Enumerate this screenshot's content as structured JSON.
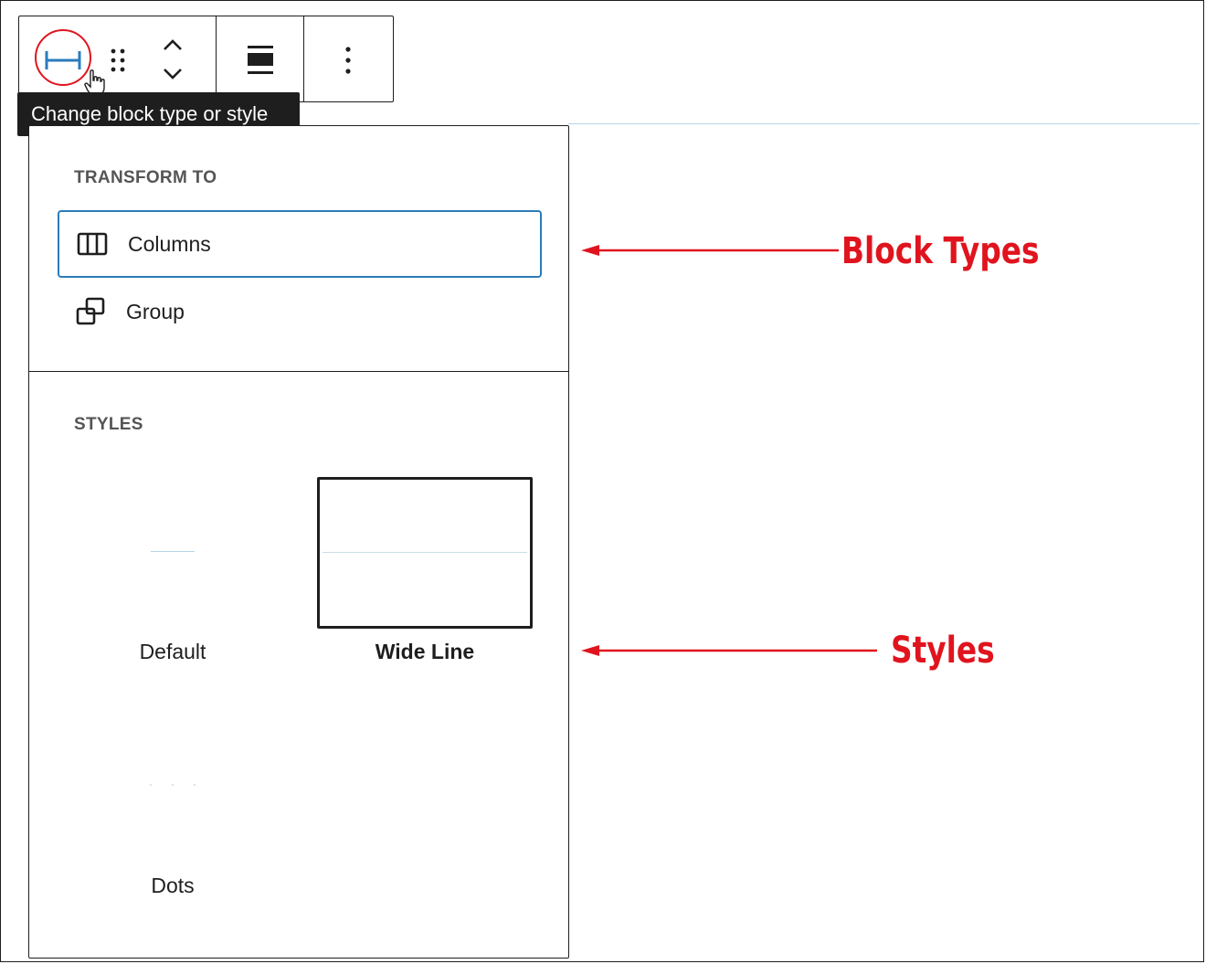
{
  "toolbar": {
    "buttons": [
      {
        "icon": "separator-block-icon"
      },
      {
        "icon": "drag-handle-icon"
      },
      {
        "icon": "move-up-icon"
      },
      {
        "icon": "move-down-icon"
      },
      {
        "icon": "align-icon"
      },
      {
        "icon": "options-icon"
      }
    ],
    "tooltip": "Change block type or style"
  },
  "panel": {
    "transform_title": "TRANSFORM TO",
    "transform_items": [
      {
        "label": "Columns",
        "icon": "columns-icon",
        "focused": true
      },
      {
        "label": "Group",
        "icon": "group-icon",
        "focused": false
      }
    ],
    "styles_title": "STYLES",
    "styles": [
      {
        "label": "Default",
        "selected": false
      },
      {
        "label": "Wide Line",
        "selected": true
      },
      {
        "label": "Dots",
        "selected": false
      }
    ]
  },
  "annotations": {
    "block_types": "Block Types",
    "styles": "Styles",
    "color": "#e0141e"
  },
  "colors": {
    "accent": "#2a7cbb",
    "highlight": "#e0141e",
    "tooltip_bg": "#1e1e1e"
  }
}
